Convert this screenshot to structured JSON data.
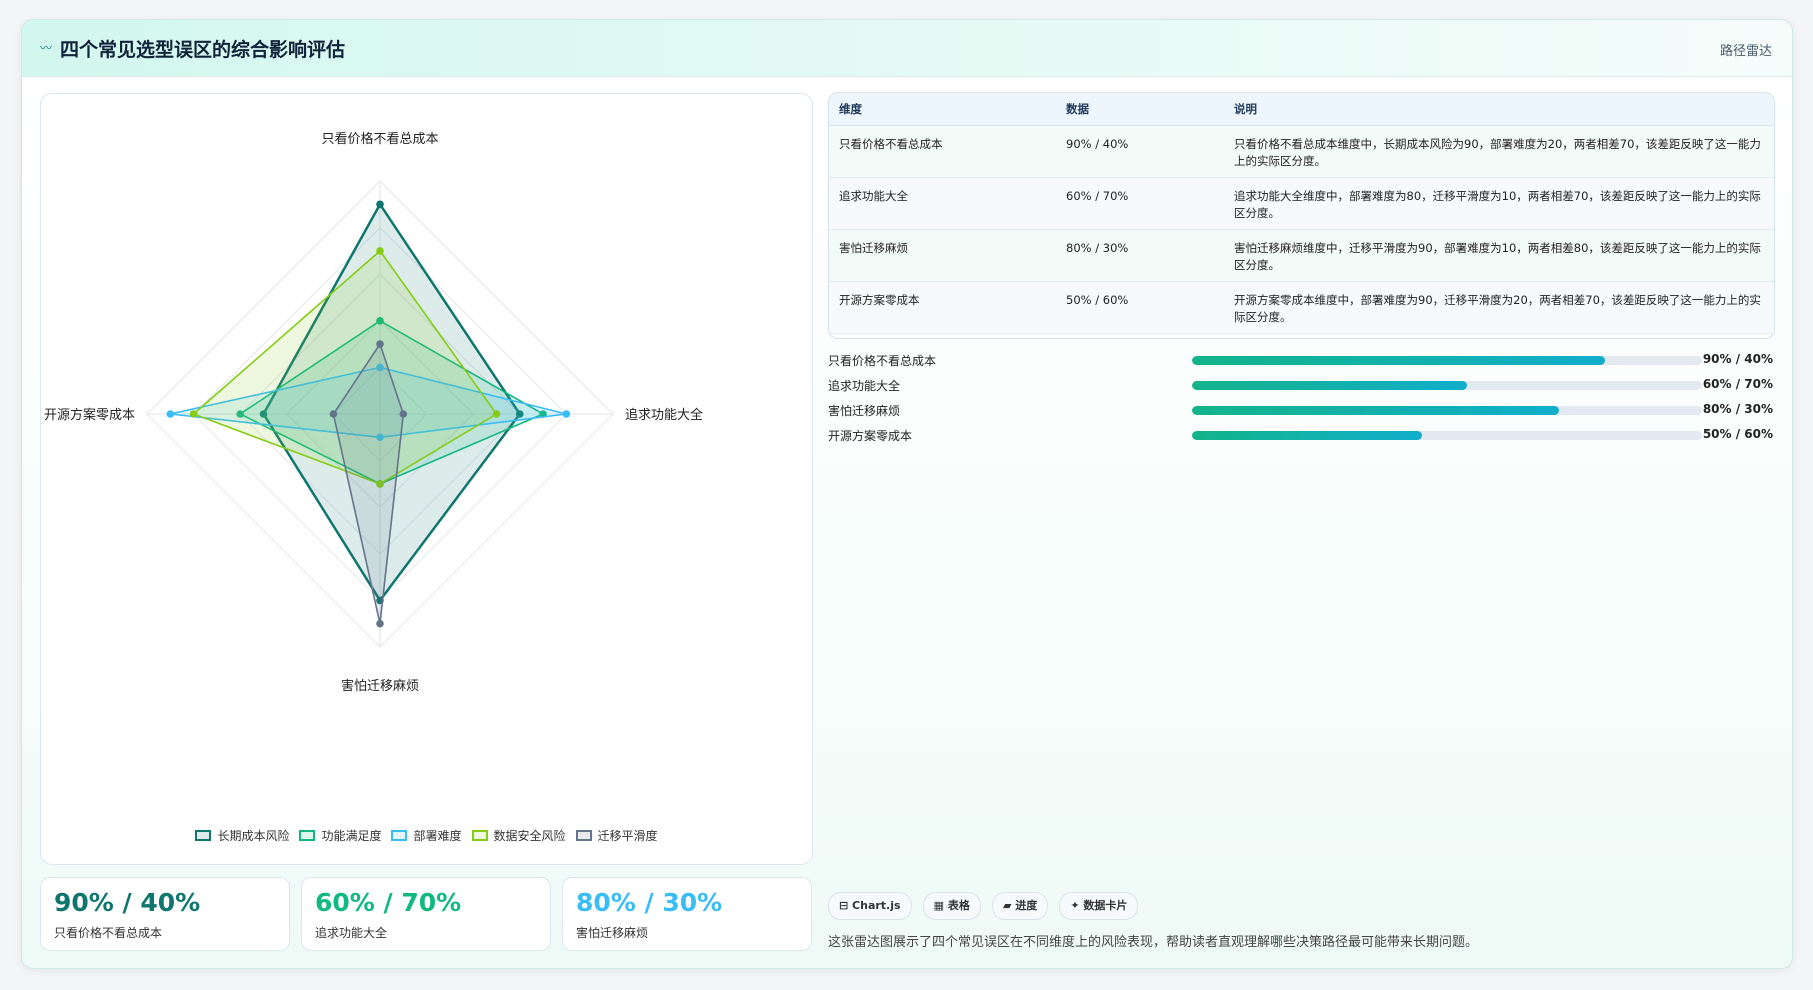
{
  "header": {
    "icon": "wave-icon",
    "title": "四个常见选型误区的综合影响评估",
    "tag": "路径雷达"
  },
  "chart_data": {
    "type": "radar",
    "axes": [
      "只看价格不看总成本",
      "追求功能大全",
      "害怕迁移麻烦",
      "开源方案零成本"
    ],
    "rmax": 100,
    "series": [
      {
        "name": "长期成本风险",
        "values": [
          90,
          60,
          80,
          50
        ],
        "color": "#0f766e"
      },
      {
        "name": "功能满足度",
        "values": [
          40,
          70,
          30,
          60
        ],
        "color": "#10b981"
      },
      {
        "name": "部署难度",
        "values": [
          20,
          80,
          10,
          90
        ],
        "color": "#38bdf8"
      },
      {
        "name": "数据安全风险",
        "values": [
          70,
          50,
          30,
          80
        ],
        "color": "#84cc16"
      },
      {
        "name": "迁移平滑度",
        "values": [
          30,
          10,
          90,
          20
        ],
        "color": "#64748b"
      }
    ]
  },
  "stats": [
    {
      "value": "90% / 40%",
      "label": "只看价格不看总成本",
      "color": "#0f766e"
    },
    {
      "value": "60% / 70%",
      "label": "追求功能大全",
      "color": "#10b981"
    },
    {
      "value": "80% / 30%",
      "label": "害怕迁移麻烦",
      "color": "#38bdf8"
    }
  ],
  "table": {
    "headers": [
      "维度",
      "数据",
      "说明"
    ],
    "rows": [
      {
        "dim": "只看价格不看总成本",
        "data": "90% / 40%",
        "note": "只看价格不看总成本维度中，长期成本风险为90，部署难度为20，两者相差70，该差距反映了这一能力上的实际区分度。"
      },
      {
        "dim": "追求功能大全",
        "data": "60% / 70%",
        "note": "追求功能大全维度中，部署难度为80，迁移平滑度为10，两者相差70，该差距反映了这一能力上的实际区分度。"
      },
      {
        "dim": "害怕迁移麻烦",
        "data": "80% / 30%",
        "note": "害怕迁移麻烦维度中，迁移平滑度为90，部署难度为10，两者相差80，该差距反映了这一能力上的实际区分度。"
      },
      {
        "dim": "开源方案零成本",
        "data": "50% / 60%",
        "note": "开源方案零成本维度中，部署难度为90，迁移平滑度为20，两者相差70，该差距反映了这一能力上的实际区分度。"
      }
    ]
  },
  "bars": [
    {
      "label": "只看价格不看总成本",
      "value": "90% / 40%",
      "fill": 0.81
    },
    {
      "label": "追求功能大全",
      "value": "60% / 70%",
      "fill": 0.54
    },
    {
      "label": "害怕迁移麻烦",
      "value": "80% / 30%",
      "fill": 0.72
    },
    {
      "label": "开源方案零成本",
      "value": "50% / 60%",
      "fill": 0.45
    }
  ],
  "chips": [
    {
      "icon": "chart-icon",
      "label": "⊟ Chart.js"
    },
    {
      "icon": "table-icon",
      "label": "▦ 表格"
    },
    {
      "icon": "progress-icon",
      "label": "▰ 进度"
    },
    {
      "icon": "card-icon",
      "label": "✦ 数据卡片"
    }
  ],
  "description": "这张雷达图展示了四个常见误区在不同维度上的风险表现，帮助读者直观理解哪些决策路径最可能带来长期问题。"
}
